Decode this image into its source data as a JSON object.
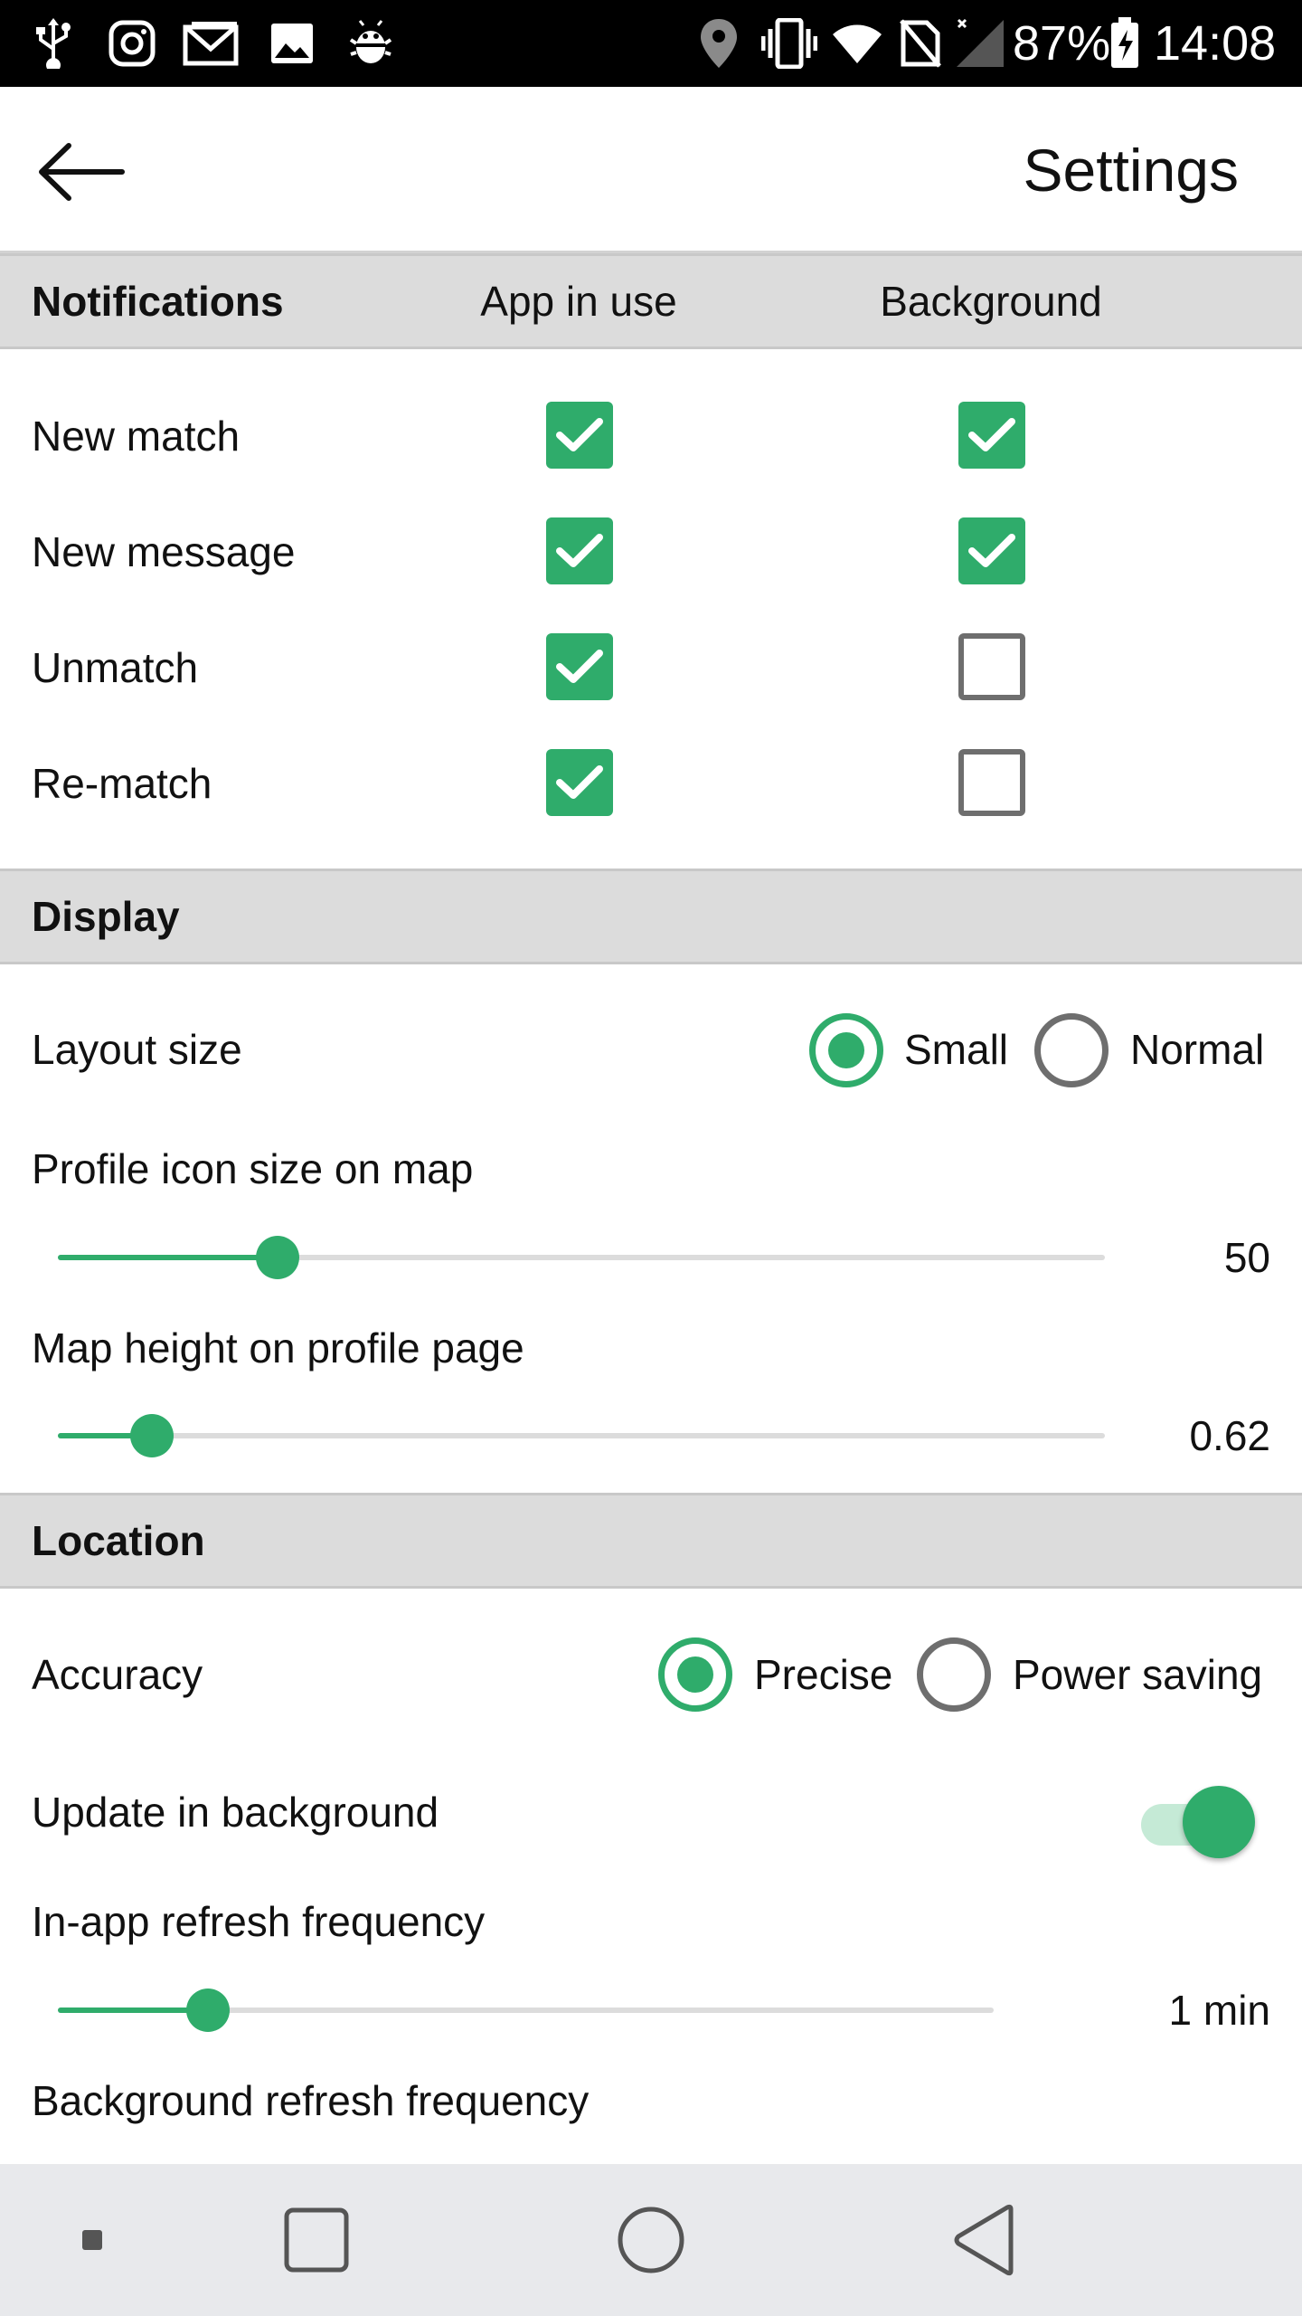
{
  "status_bar": {
    "battery_percent": "87%",
    "time": "14:08",
    "icons": [
      "usb-icon",
      "instagram-icon",
      "gmail-icon",
      "image-icon",
      "android-debug-icon",
      "location-pin-icon",
      "vibrate-icon",
      "wifi-icon",
      "no-sim-icon",
      "signal-icon",
      "battery-charging-icon"
    ]
  },
  "app_bar": {
    "title": "Settings",
    "back_icon": "arrow-left-icon"
  },
  "notifications": {
    "header": "Notifications",
    "col_app_in_use": "App in use",
    "col_background": "Background",
    "rows": [
      {
        "label": "New match",
        "app_in_use": true,
        "background": true
      },
      {
        "label": "New message",
        "app_in_use": true,
        "background": true
      },
      {
        "label": "Unmatch",
        "app_in_use": true,
        "background": false
      },
      {
        "label": "Re-match",
        "app_in_use": true,
        "background": false
      }
    ]
  },
  "display": {
    "header": "Display",
    "layout_size": {
      "label": "Layout size",
      "options": [
        "Small",
        "Normal"
      ],
      "selected": "Small"
    },
    "profile_icon_size": {
      "label": "Profile icon size on map",
      "value": "50",
      "level": 0.21
    },
    "map_height": {
      "label": "Map height on profile page",
      "value": "0.62",
      "level": 0.09
    }
  },
  "location": {
    "header": "Location",
    "accuracy": {
      "label": "Accuracy",
      "options": [
        "Precise",
        "Power saving"
      ],
      "selected": "Precise"
    },
    "update_in_background": {
      "label": "Update in background",
      "on": true
    },
    "in_app_refresh": {
      "label": "In-app refresh frequency",
      "value": "1 min",
      "level": 0.16
    },
    "background_refresh": {
      "label": "Background refresh frequency"
    }
  },
  "nav_bar": {
    "icons": [
      "notification-dot-icon",
      "recents-square-icon",
      "home-circle-icon",
      "back-triangle-icon"
    ]
  },
  "colors": {
    "accent": "#2fac6b",
    "section_bg": "#dcdcdc",
    "status_bar_bg": "#000000",
    "nav_bar_bg": "#e8e9ec"
  }
}
